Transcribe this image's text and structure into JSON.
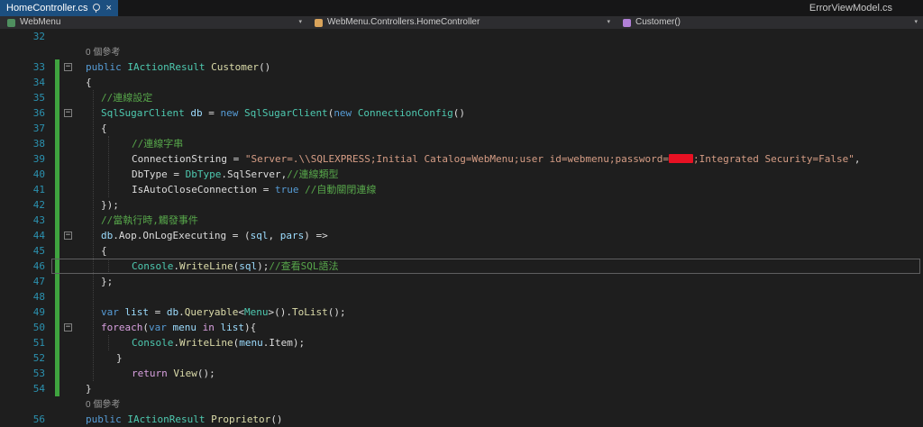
{
  "window": {
    "active_tab": "HomeController.cs",
    "right_tab": "ErrorViewModel.cs"
  },
  "breadcrumb": {
    "project": "WebMenu",
    "type": "WebMenu.Controllers.HomeController",
    "member": "Customer()"
  },
  "colors": {
    "editor_bg": "#1e1e1e",
    "tabbar_bg": "#161617",
    "navbar_bg": "#2d2d30",
    "active_tab_bg": "#1c4f80",
    "tab_text": "#ffffff",
    "crumb_text": "#cccccc",
    "line_number": "#2b91af",
    "change_bar": "#3fa33f",
    "redaction": "#e81123",
    "keyword": "#569cd6",
    "control": "#d8a0df",
    "type": "#4ec9b0",
    "method": "#dcdcaa",
    "variable": "#9cdcfe",
    "string": "#d69d85",
    "comment": "#57a64a",
    "text": "#dcdcdc",
    "codelens": "#999999"
  },
  "editor": {
    "codelens_label": "0 個參考",
    "rows": [
      {
        "n": "32",
        "i": 10,
        "toks": []
      },
      {
        "lens": true,
        "i": 10,
        "toks": [
          [
            "lens",
            "0 個參考"
          ]
        ]
      },
      {
        "n": "33",
        "i": 10,
        "chg": true,
        "fold": true,
        "toks": [
          [
            "kw",
            "public "
          ],
          [
            "type",
            "IActionResult "
          ],
          [
            "meth",
            "Customer"
          ],
          [
            "pln",
            "()"
          ]
        ]
      },
      {
        "n": "34",
        "i": 10,
        "chg": true,
        "toks": [
          [
            "pln",
            "{"
          ]
        ]
      },
      {
        "n": "35",
        "i": 27,
        "chg": true,
        "toks": [
          [
            "com",
            "//連線設定"
          ]
        ]
      },
      {
        "n": "36",
        "i": 27,
        "chg": true,
        "fold": true,
        "toks": [
          [
            "type",
            "SqlSugarClient "
          ],
          [
            "var",
            "db "
          ],
          [
            "pln",
            "= "
          ],
          [
            "kw",
            "new "
          ],
          [
            "type",
            "SqlSugarClient"
          ],
          [
            "pln",
            "("
          ],
          [
            "kw",
            "new "
          ],
          [
            "type",
            "ConnectionConfig"
          ],
          [
            "pln",
            "()"
          ]
        ]
      },
      {
        "n": "37",
        "i": 27,
        "chg": true,
        "toks": [
          [
            "pln",
            "{"
          ]
        ]
      },
      {
        "n": "38",
        "i": 61,
        "chg": true,
        "toks": [
          [
            "com",
            "//連線字串"
          ]
        ]
      },
      {
        "n": "39",
        "i": 61,
        "chg": true,
        "toks": [
          [
            "pln",
            "ConnectionString = "
          ],
          [
            "str",
            "\"Server=.\\\\SQLEXPRESS;Initial Catalog=WebMenu;user id=webmenu;password="
          ],
          [
            "redact",
            ""
          ],
          [
            "str",
            ";Integrated Security=False\""
          ],
          [
            "pln",
            ","
          ]
        ]
      },
      {
        "n": "40",
        "i": 61,
        "chg": true,
        "toks": [
          [
            "pln",
            "DbType = "
          ],
          [
            "type",
            "DbType"
          ],
          [
            "pln",
            ".SqlServer,"
          ],
          [
            "com",
            "//連線類型"
          ]
        ]
      },
      {
        "n": "41",
        "i": 61,
        "chg": true,
        "toks": [
          [
            "pln",
            "IsAutoCloseConnection = "
          ],
          [
            "kw",
            "true "
          ],
          [
            "com",
            "//自動關閉連線"
          ]
        ]
      },
      {
        "n": "42",
        "i": 27,
        "chg": true,
        "toks": [
          [
            "pln",
            "});"
          ]
        ]
      },
      {
        "n": "43",
        "i": 27,
        "chg": true,
        "toks": [
          [
            "com",
            "//當執行時,觸發事件"
          ]
        ]
      },
      {
        "n": "44",
        "i": 27,
        "chg": true,
        "fold": true,
        "toks": [
          [
            "var",
            "db"
          ],
          [
            "pln",
            ".Aop.OnLogExecuting = ("
          ],
          [
            "var",
            "sql"
          ],
          [
            "pln",
            ", "
          ],
          [
            "var",
            "pars"
          ],
          [
            "pln",
            ") =>"
          ]
        ]
      },
      {
        "n": "45",
        "i": 27,
        "chg": true,
        "toks": [
          [
            "pln",
            "{"
          ]
        ]
      },
      {
        "n": "46",
        "i": 61,
        "chg": true,
        "cur": true,
        "toks": [
          [
            "type",
            "Console"
          ],
          [
            "pln",
            "."
          ],
          [
            "meth",
            "WriteLine"
          ],
          [
            "pln",
            "("
          ],
          [
            "var",
            "sql"
          ],
          [
            "pln",
            ");"
          ],
          [
            "com",
            "//查看SQL語法"
          ]
        ]
      },
      {
        "n": "47",
        "i": 27,
        "chg": true,
        "toks": [
          [
            "pln",
            "};"
          ]
        ]
      },
      {
        "n": "48",
        "i": 27,
        "chg": true,
        "toks": []
      },
      {
        "n": "49",
        "i": 27,
        "chg": true,
        "toks": [
          [
            "kw",
            "var "
          ],
          [
            "var",
            "list "
          ],
          [
            "pln",
            "= "
          ],
          [
            "var",
            "db"
          ],
          [
            "pln",
            "."
          ],
          [
            "meth",
            "Queryable"
          ],
          [
            "pln",
            "<"
          ],
          [
            "type",
            "Menu"
          ],
          [
            "pln",
            ">()."
          ],
          [
            "meth",
            "ToList"
          ],
          [
            "pln",
            "();"
          ]
        ]
      },
      {
        "n": "50",
        "i": 27,
        "chg": true,
        "fold": true,
        "toks": [
          [
            "ctl",
            "foreach"
          ],
          [
            "pln",
            "("
          ],
          [
            "kw",
            "var "
          ],
          [
            "var",
            "menu "
          ],
          [
            "ctl",
            "in "
          ],
          [
            "var",
            "list"
          ],
          [
            "pln",
            "){"
          ]
        ]
      },
      {
        "n": "51",
        "i": 61,
        "chg": true,
        "toks": [
          [
            "type",
            "Console"
          ],
          [
            "pln",
            "."
          ],
          [
            "meth",
            "WriteLine"
          ],
          [
            "pln",
            "("
          ],
          [
            "var",
            "menu"
          ],
          [
            "pln",
            ".Item);"
          ]
        ]
      },
      {
        "n": "52",
        "i": 44,
        "chg": true,
        "toks": [
          [
            "pln",
            "}"
          ]
        ]
      },
      {
        "n": "53",
        "i": 61,
        "chg": true,
        "toks": [
          [
            "ctl",
            "return "
          ],
          [
            "meth",
            "View"
          ],
          [
            "pln",
            "();"
          ]
        ]
      },
      {
        "n": "54",
        "i": 10,
        "chg": true,
        "toks": [
          [
            "pln",
            "}"
          ]
        ]
      },
      {
        "lens": true,
        "i": 10,
        "toks": [
          [
            "lens",
            "0 個參考"
          ]
        ]
      },
      {
        "n": "56",
        "i": 10,
        "toks": [
          [
            "kw",
            "public "
          ],
          [
            "type",
            "IActionResult "
          ],
          [
            "meth",
            "Proprietor"
          ],
          [
            "pln",
            "()"
          ]
        ]
      }
    ]
  }
}
